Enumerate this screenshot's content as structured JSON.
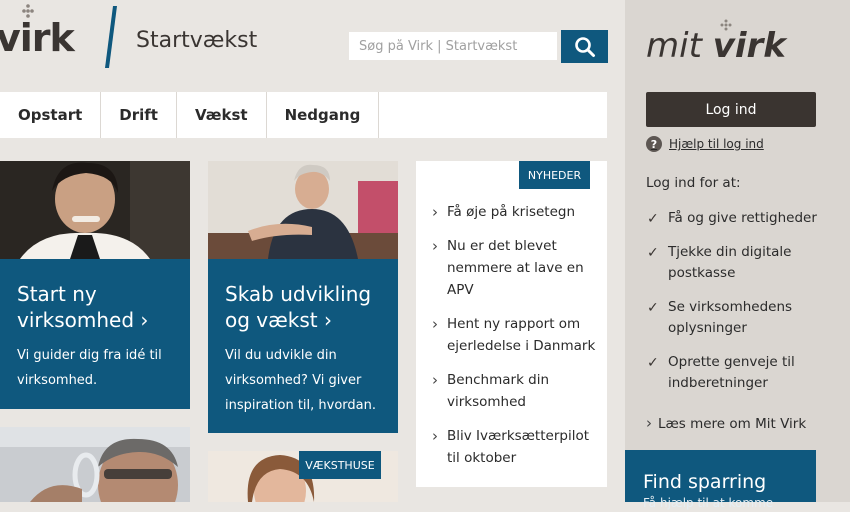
{
  "header": {
    "logo_text": "virk",
    "site_title": "Startvækst",
    "search_placeholder": "Søg på Virk | Startvækst"
  },
  "nav": {
    "items": [
      {
        "label": "Opstart"
      },
      {
        "label": "Drift"
      },
      {
        "label": "Vækst"
      },
      {
        "label": "Nedgang"
      }
    ]
  },
  "cards": [
    {
      "title": "Start ny virksomhed",
      "arrow": "›",
      "desc": "Vi guider dig fra idé til virksomhed."
    },
    {
      "title": "Skab udvikling og vækst",
      "arrow": "›",
      "desc": "Vil du udvikle din virksomhed? Vi giver inspiration til, hvordan."
    }
  ],
  "news": {
    "badge": "NYHEDER",
    "items": [
      "Få øje på krisetegn",
      "Nu er det blevet nemmere at lave en APV",
      "Hent ny rapport om ejerledelse i Danmark",
      "Benchmark din virksomhed",
      "Bliv Iværksætterpilot til oktober"
    ]
  },
  "vaeksthuse_badge": "VÆKSTHUSE",
  "mitvirk": {
    "logo_mit": "mit",
    "logo_virk": "virk",
    "login_label": "Log ind",
    "help_label": "Hjælp til log ind",
    "login_for": "Log ind for at:",
    "checks": [
      "Få og give rettigheder",
      "Tjekke din digitale postkasse",
      "Se virksomhedens oplysninger",
      "Oprette genveje til indberetninger"
    ],
    "read_more": "Læs mere om Mit Virk",
    "find_title": "Find sparring",
    "find_sub": "Få hjælp til at komme"
  },
  "colors": {
    "brand_blue": "#0f587e",
    "dark": "#3a3430",
    "background": "#e9e6e2",
    "sidebar": "#dad6d1"
  }
}
